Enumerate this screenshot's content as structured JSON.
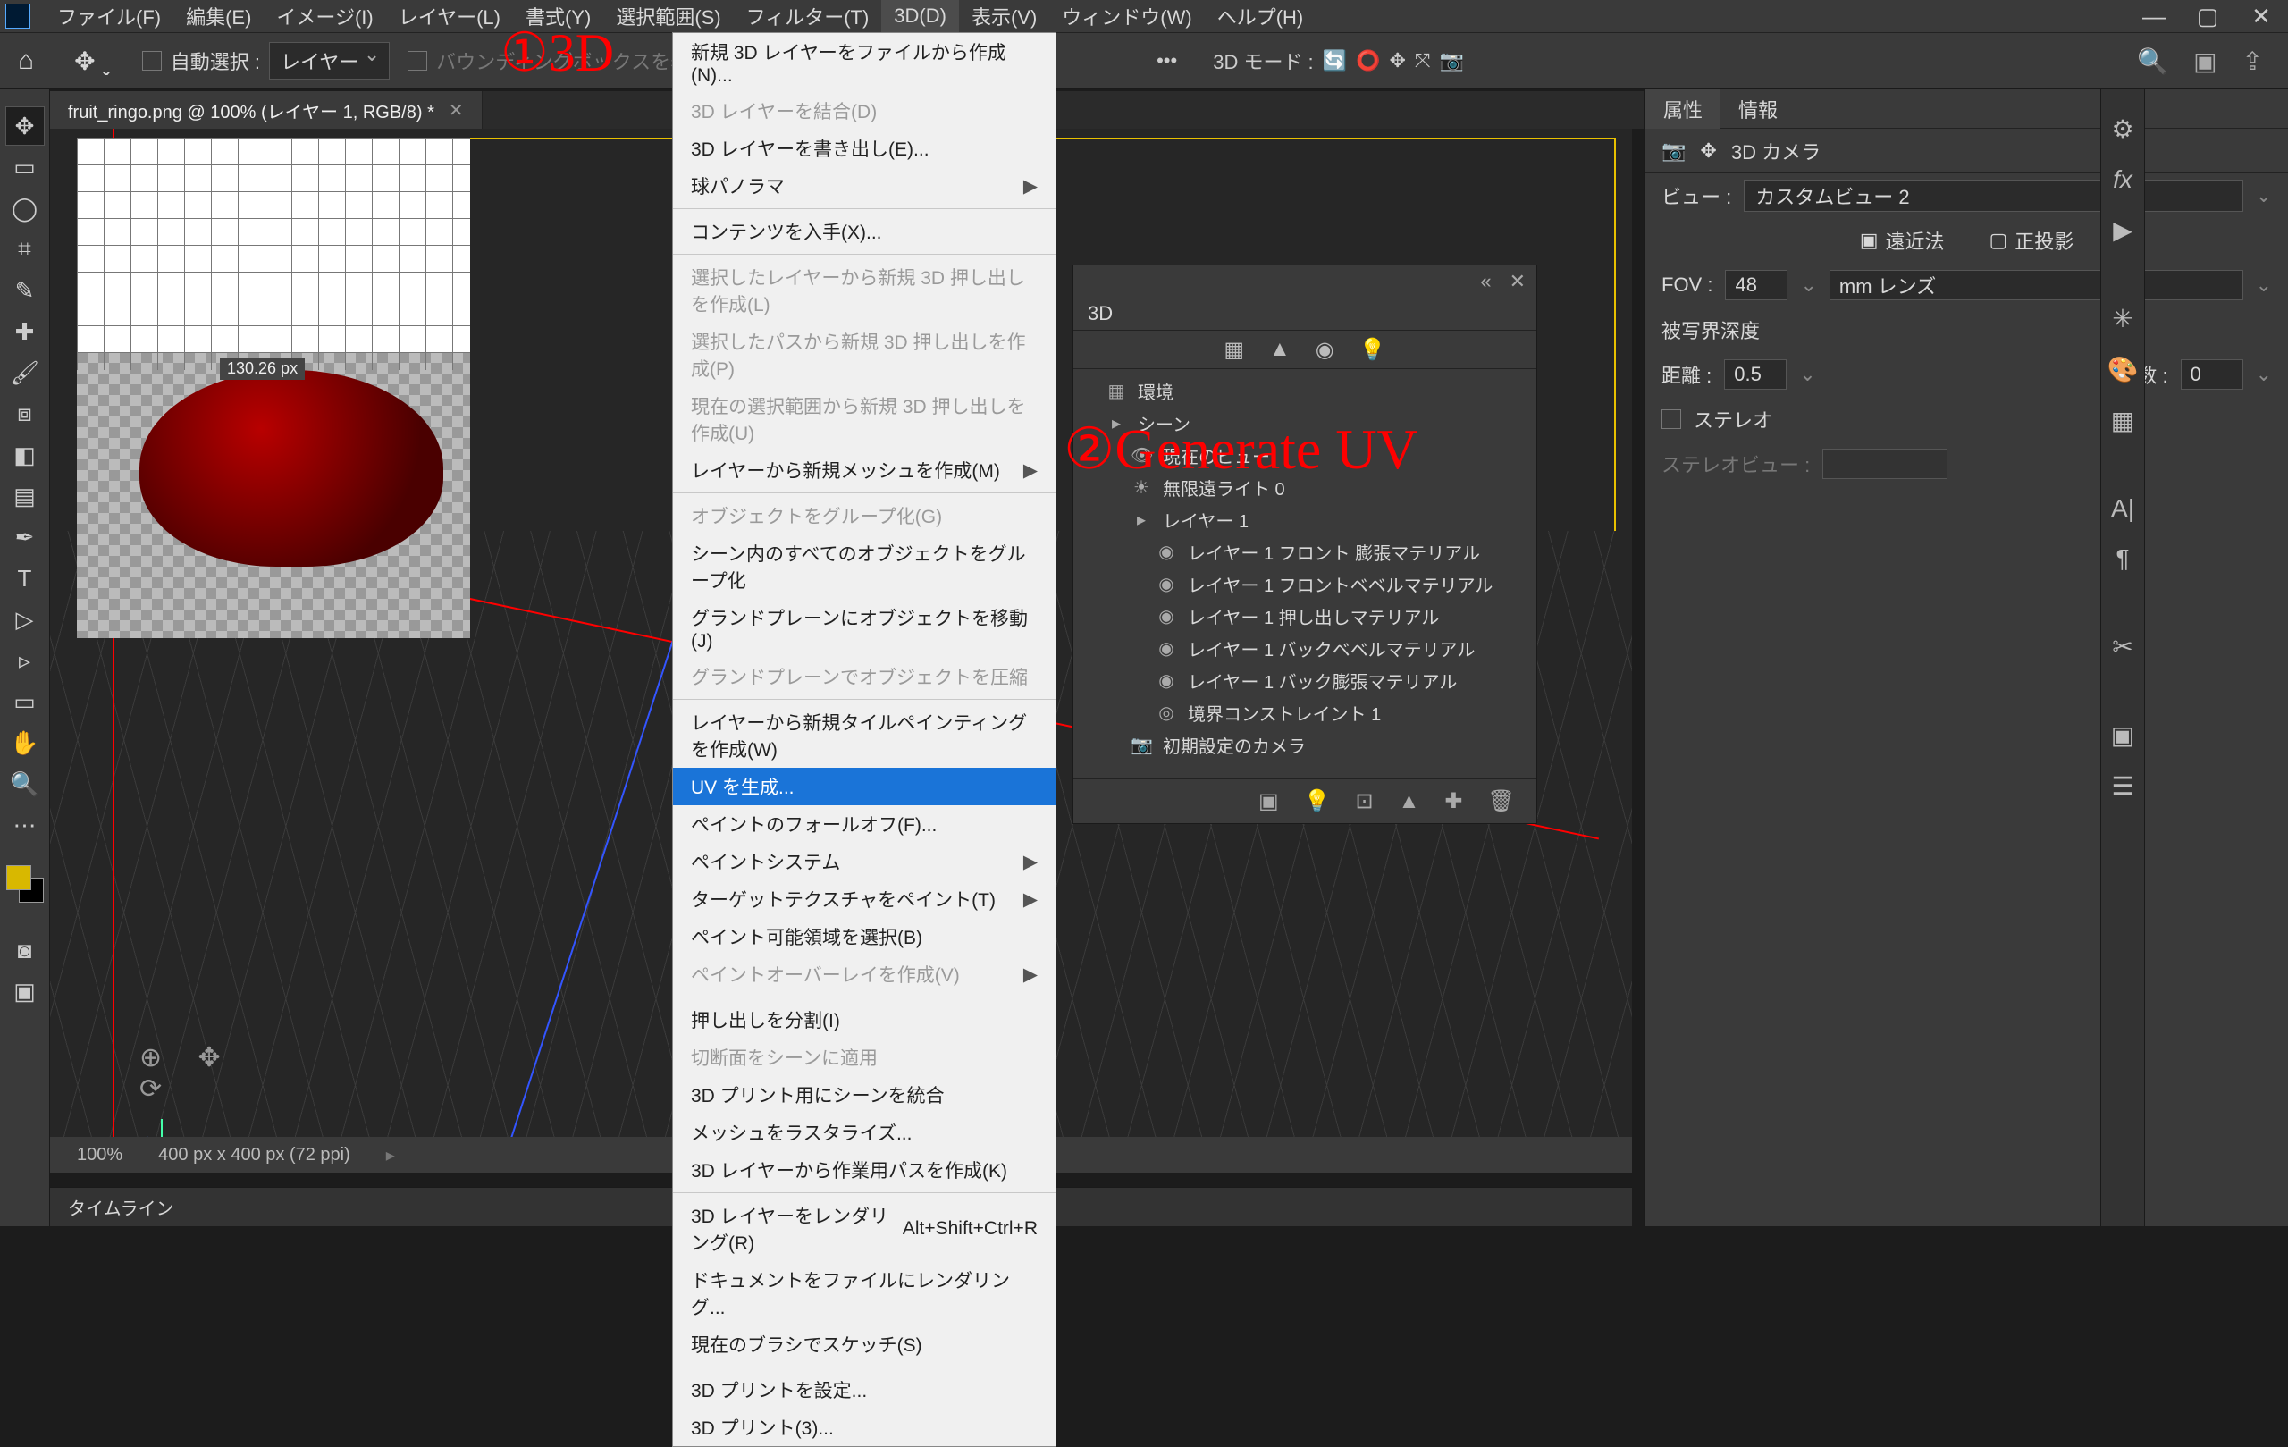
{
  "menubar": {
    "items": [
      "ファイル(F)",
      "編集(E)",
      "イメージ(I)",
      "レイヤー(L)",
      "書式(Y)",
      "選択範囲(S)",
      "フィルター(T)",
      "3D(D)",
      "表示(V)",
      "ウィンドウ(W)",
      "ヘルプ(H)"
    ],
    "active_index": 7
  },
  "optionsbar": {
    "auto_select_label": "自動選択 :",
    "layer_drop": "レイヤー",
    "bbox_label": "バウンディングボックスを表示",
    "mode_label": "3D モード :"
  },
  "annotations": {
    "a1": "①3D",
    "a2": "②Generate UV"
  },
  "doc_tab": {
    "title": "fruit_ringo.png @ 100% (レイヤー 1, RGB/8) *"
  },
  "ruler_value": "130.26 px",
  "statusbar": {
    "zoom": "100%",
    "dims": "400 px x 400 px (72 ppi)"
  },
  "timeline_label": "タイムライン",
  "dropdown": {
    "items": [
      {
        "t": "新規 3D レイヤーをファイルから作成(N)...",
        "dis": false
      },
      {
        "t": "3D レイヤーを結合(D)",
        "dis": true
      },
      {
        "t": "3D レイヤーを書き出し(E)...",
        "dis": false
      },
      {
        "t": "球パノラマ",
        "dis": false,
        "sub": true
      },
      {
        "sep": true
      },
      {
        "t": "コンテンツを入手(X)...",
        "dis": false
      },
      {
        "sep": true
      },
      {
        "t": "選択したレイヤーから新規 3D 押し出しを作成(L)",
        "dis": true
      },
      {
        "t": "選択したパスから新規 3D 押し出しを作成(P)",
        "dis": true
      },
      {
        "t": "現在の選択範囲から新規 3D 押し出しを作成(U)",
        "dis": true
      },
      {
        "t": "レイヤーから新規メッシュを作成(M)",
        "dis": false,
        "sub": true
      },
      {
        "sep": true
      },
      {
        "t": "オブジェクトをグループ化(G)",
        "dis": true
      },
      {
        "t": "シーン内のすべてのオブジェクトをグループ化",
        "dis": false
      },
      {
        "t": "グランドプレーンにオブジェクトを移動(J)",
        "dis": false
      },
      {
        "t": "グランドプレーンでオブジェクトを圧縮",
        "dis": true
      },
      {
        "sep": true
      },
      {
        "t": "レイヤーから新規タイルペインティングを作成(W)",
        "dis": false
      },
      {
        "t": "UV を生成...",
        "dis": false,
        "hl": true
      },
      {
        "t": "ペイントのフォールオフ(F)...",
        "dis": false
      },
      {
        "t": "ペイントシステム",
        "dis": false,
        "sub": true
      },
      {
        "t": "ターゲットテクスチャをペイント(T)",
        "dis": false,
        "sub": true
      },
      {
        "t": "ペイント可能領域を選択(B)",
        "dis": false
      },
      {
        "t": "ペイントオーバーレイを作成(V)",
        "dis": true,
        "sub": true
      },
      {
        "sep": true
      },
      {
        "t": "押し出しを分割(I)",
        "dis": false
      },
      {
        "t": "切断面をシーンに適用",
        "dis": true
      },
      {
        "t": "3D プリント用にシーンを統合",
        "dis": false
      },
      {
        "t": "メッシュをラスタライズ...",
        "dis": false
      },
      {
        "t": "3D レイヤーから作業用パスを作成(K)",
        "dis": false
      },
      {
        "sep": true
      },
      {
        "t": "3D レイヤーをレンダリング(R)",
        "dis": false,
        "hint": "Alt+Shift+Ctrl+R"
      },
      {
        "t": "ドキュメントをファイルにレンダリング...",
        "dis": false
      },
      {
        "t": "現在のブラシでスケッチ(S)",
        "dis": false
      },
      {
        "sep": true
      },
      {
        "t": "3D プリントを設定...",
        "dis": false
      },
      {
        "t": "3D プリント(3)...",
        "dis": false
      }
    ]
  },
  "panel3d": {
    "tab": "3D",
    "tree": [
      {
        "ind": 0,
        "ic": "▦",
        "t": "環境"
      },
      {
        "ind": 0,
        "ic": "▸",
        "t": "シーン"
      },
      {
        "ind": 1,
        "ic": "👁",
        "t": "現在のビュー"
      },
      {
        "ind": 1,
        "ic": "☀",
        "t": "無限遠ライト 0"
      },
      {
        "ind": 1,
        "ic": "▸",
        "t": "レイヤー 1"
      },
      {
        "ind": 2,
        "ic": "◉",
        "t": "レイヤー 1 フロント 膨張マテリアル"
      },
      {
        "ind": 2,
        "ic": "◉",
        "t": "レイヤー 1 フロントベベルマテリアル"
      },
      {
        "ind": 2,
        "ic": "◉",
        "t": "レイヤー 1 押し出しマテリアル"
      },
      {
        "ind": 2,
        "ic": "◉",
        "t": "レイヤー 1 バックベベルマテリアル"
      },
      {
        "ind": 2,
        "ic": "◉",
        "t": "レイヤー 1 バック膨張マテリアル"
      },
      {
        "ind": 2,
        "ic": "◎",
        "t": "境界コンストレイント 1"
      },
      {
        "ind": 1,
        "ic": "📷",
        "t": "初期設定のカメラ"
      }
    ]
  },
  "properties": {
    "tabs": [
      "属性",
      "情報"
    ],
    "header": "3D カメラ",
    "view_label": "ビュー :",
    "view_value": "カスタムビュー 2",
    "persp": "遠近法",
    "ortho": "正投影",
    "fov_label": "FOV :",
    "fov_value": "48",
    "fov_unit": "mm レンズ",
    "dof_label": "被写界深度",
    "dist_label": "距離 :",
    "dist_value": "0.5",
    "colors_label": "色数 :",
    "colors_value": "0",
    "stereo_label": "ステレオ",
    "stereo_view_label": "ステレオビュー :"
  }
}
